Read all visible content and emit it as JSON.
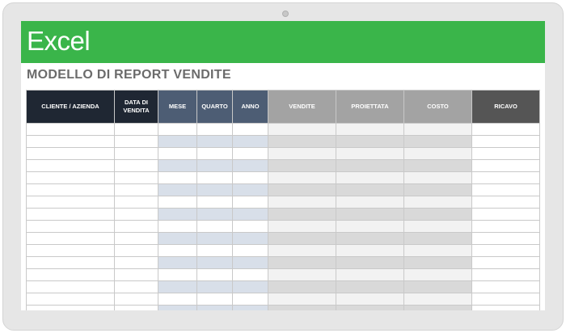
{
  "app": {
    "title": "Excel"
  },
  "sheet": {
    "heading": "MODELLO DI REPORT VENDITE"
  },
  "table": {
    "columns": [
      {
        "label": "CLIENTE / AZIENDA",
        "group": "dark"
      },
      {
        "label": "DATA DI VENDITA",
        "group": "dark"
      },
      {
        "label": "MESE",
        "group": "blue"
      },
      {
        "label": "QUARTO",
        "group": "blue"
      },
      {
        "label": "ANNO",
        "group": "blue"
      },
      {
        "label": "VENDITE",
        "group": "gray"
      },
      {
        "label": "PROIETTATA",
        "group": "gray"
      },
      {
        "label": "COSTO",
        "group": "gray"
      },
      {
        "label": "RICAVO",
        "group": "rev"
      }
    ],
    "visible_rows": 16
  },
  "colors": {
    "banner": "#3ab54a",
    "header_dark": "#1f2733",
    "header_blue": "#4d5d74",
    "header_gray": "#a3a3a3",
    "header_revenue": "#555555"
  }
}
